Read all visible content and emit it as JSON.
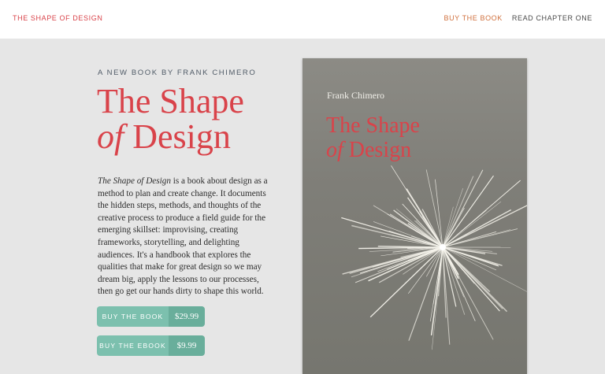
{
  "header": {
    "brand": "THE SHAPE OF DESIGN",
    "nav": {
      "buy": "BUY THE BOOK",
      "read": "READ CHAPTER ONE"
    }
  },
  "hero": {
    "eyebrow": "A NEW BOOK BY FRANK CHIMERO",
    "title_line1": "The Shape",
    "title_of": "of",
    "title_design": " Design",
    "desc_title": "The Shape of Design",
    "desc_body": " is a book about design as a method to plan and create change. It documents the hidden steps, methods, and thoughts of the creative process to produce a field guide for the emerging skillset: improvising, creating frameworks, storytelling, and delighting audiences. It's a handbook that explores the qualities that make for great design so we may dream big, apply the lessons to our processes, then go get our hands dirty to shape this world."
  },
  "buttons": [
    {
      "label": "BUY THE BOOK",
      "price": "$29.99"
    },
    {
      "label": "BUY THE EBOOK",
      "price": "$9.99"
    }
  ],
  "cover": {
    "author": "Frank Chimero",
    "title_line1": "The Shape",
    "title_of": "of",
    "title_design": " Design"
  },
  "colors": {
    "accent": "#d9434a",
    "button": "#7cc0ae",
    "button_price": "#69ae9b",
    "cover": "#82817b"
  }
}
